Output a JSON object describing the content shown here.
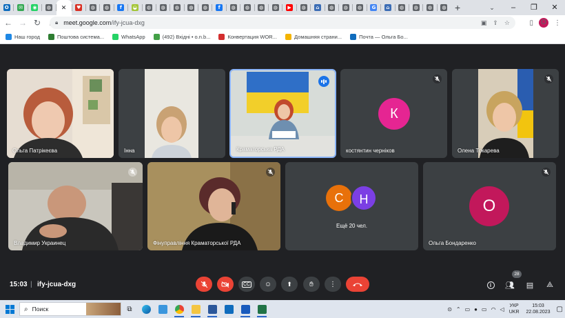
{
  "browser": {
    "tabs": [
      {
        "icon": "outlook-icon",
        "color": "#0f6cbd",
        "glyph": "O"
      },
      {
        "icon": "mail-icon",
        "color": "#34a853",
        "glyph": "✉"
      },
      {
        "icon": "whatsapp-icon",
        "color": "#25d366",
        "glyph": "◉"
      },
      {
        "icon": "globe-icon",
        "color": "#5f6368",
        "glyph": "◍"
      },
      {
        "icon": "close-icon",
        "color": "#202124",
        "glyph": "✕"
      },
      {
        "icon": "heart-icon",
        "color": "#d93025",
        "glyph": "♥"
      },
      {
        "icon": "globe-icon",
        "color": "#5f6368",
        "glyph": "◍"
      },
      {
        "icon": "globe-icon",
        "color": "#5f6368",
        "glyph": "◍"
      },
      {
        "icon": "facebook-icon",
        "color": "#1877f2",
        "glyph": "f"
      },
      {
        "icon": "android-icon",
        "color": "#a4c639",
        "glyph": "◒"
      },
      {
        "icon": "globe-icon",
        "color": "#5f6368",
        "glyph": "◍"
      },
      {
        "icon": "globe-icon",
        "color": "#5f6368",
        "glyph": "◍"
      },
      {
        "icon": "globe-icon",
        "color": "#5f6368",
        "glyph": "◍"
      },
      {
        "icon": "globe-icon",
        "color": "#5f6368",
        "glyph": "◍"
      },
      {
        "icon": "globe-icon",
        "color": "#5f6368",
        "glyph": "◍"
      },
      {
        "icon": "facebook-icon",
        "color": "#1877f2",
        "glyph": "f"
      },
      {
        "icon": "globe-icon",
        "color": "#5f6368",
        "glyph": "◍"
      },
      {
        "icon": "globe-icon",
        "color": "#5f6368",
        "glyph": "◍"
      },
      {
        "icon": "globe-icon",
        "color": "#5f6368",
        "glyph": "◍"
      },
      {
        "icon": "globe-icon",
        "color": "#5f6368",
        "glyph": "◍"
      },
      {
        "icon": "youtube-icon",
        "color": "#ff0000",
        "glyph": "▶"
      },
      {
        "icon": "globe-icon",
        "color": "#5f6368",
        "glyph": "◍"
      },
      {
        "icon": "landmark-icon",
        "color": "#3c6db5",
        "glyph": "⌂"
      },
      {
        "icon": "globe-icon",
        "color": "#5f6368",
        "glyph": "◍"
      },
      {
        "icon": "globe-icon",
        "color": "#5f6368",
        "glyph": "◍"
      },
      {
        "icon": "globe-icon",
        "color": "#5f6368",
        "glyph": "◍"
      },
      {
        "icon": "google-icon",
        "color": "#4285f4",
        "glyph": "G"
      },
      {
        "icon": "landmark-icon",
        "color": "#3c6db5",
        "glyph": "⌂"
      },
      {
        "icon": "globe-icon",
        "color": "#5f6368",
        "glyph": "◍"
      },
      {
        "icon": "globe-icon",
        "color": "#5f6368",
        "glyph": "◍"
      },
      {
        "icon": "globe-icon",
        "color": "#5f6368",
        "glyph": "◍"
      },
      {
        "icon": "globe-icon",
        "color": "#5f6368",
        "glyph": "◍"
      }
    ],
    "new_tab": "+",
    "url_host": "meet.google.com",
    "url_path": "/ify-jcua-dxg",
    "profile_letter": "О",
    "bookmarks": [
      {
        "label": "Наш город",
        "color": "#1e88e5"
      },
      {
        "label": "Поштова система...",
        "color": "#2e7d32"
      },
      {
        "label": "WhatsApp",
        "color": "#25d366"
      },
      {
        "label": "(492) Вхідні • o.n.b...",
        "color": "#43a047"
      },
      {
        "label": "Конвертация WOR...",
        "color": "#d32f2f"
      },
      {
        "label": "Домашняя страни...",
        "color": "#f4b400"
      },
      {
        "label": "Почта — Ольга Бо...",
        "color": "#0f6cbd"
      }
    ]
  },
  "meet": {
    "participants_row1": [
      {
        "name": "Ольга Патрікеєва",
        "type": "video"
      },
      {
        "name": "Інна",
        "type": "video"
      },
      {
        "name": "Краматорська РДА",
        "type": "video",
        "speaking": true
      },
      {
        "name": "костянтин черніков",
        "type": "avatar",
        "letter": "К",
        "color": "#e52592"
      },
      {
        "name": "Олена Токарева",
        "type": "video"
      }
    ],
    "participants_row2": [
      {
        "name": "Владимир Украинец",
        "type": "video"
      },
      {
        "name": "Фінуправління Краматорської РДА",
        "type": "video"
      },
      {
        "name": "Ещё 20 чел.",
        "type": "group",
        "letters": [
          "С",
          "Н"
        ],
        "colors": [
          "#e8710a",
          "#7b3fe4"
        ]
      },
      {
        "name": "Ольга Бондаренко",
        "type": "avatar",
        "letter": "О",
        "color": "#c2185b"
      }
    ],
    "time": "15:03",
    "separator": "|",
    "meeting_code": "ify-jcua-dxg",
    "participants_count": "28",
    "colors": {
      "danger": "#ea4335",
      "dark_button": "#3c4043",
      "speaking": "#1a73e8"
    }
  },
  "taskbar": {
    "search_label": "Поиск",
    "lang_top": "УКР",
    "lang_bottom": "UKR",
    "time": "15:03",
    "date": "22.08.2023"
  }
}
